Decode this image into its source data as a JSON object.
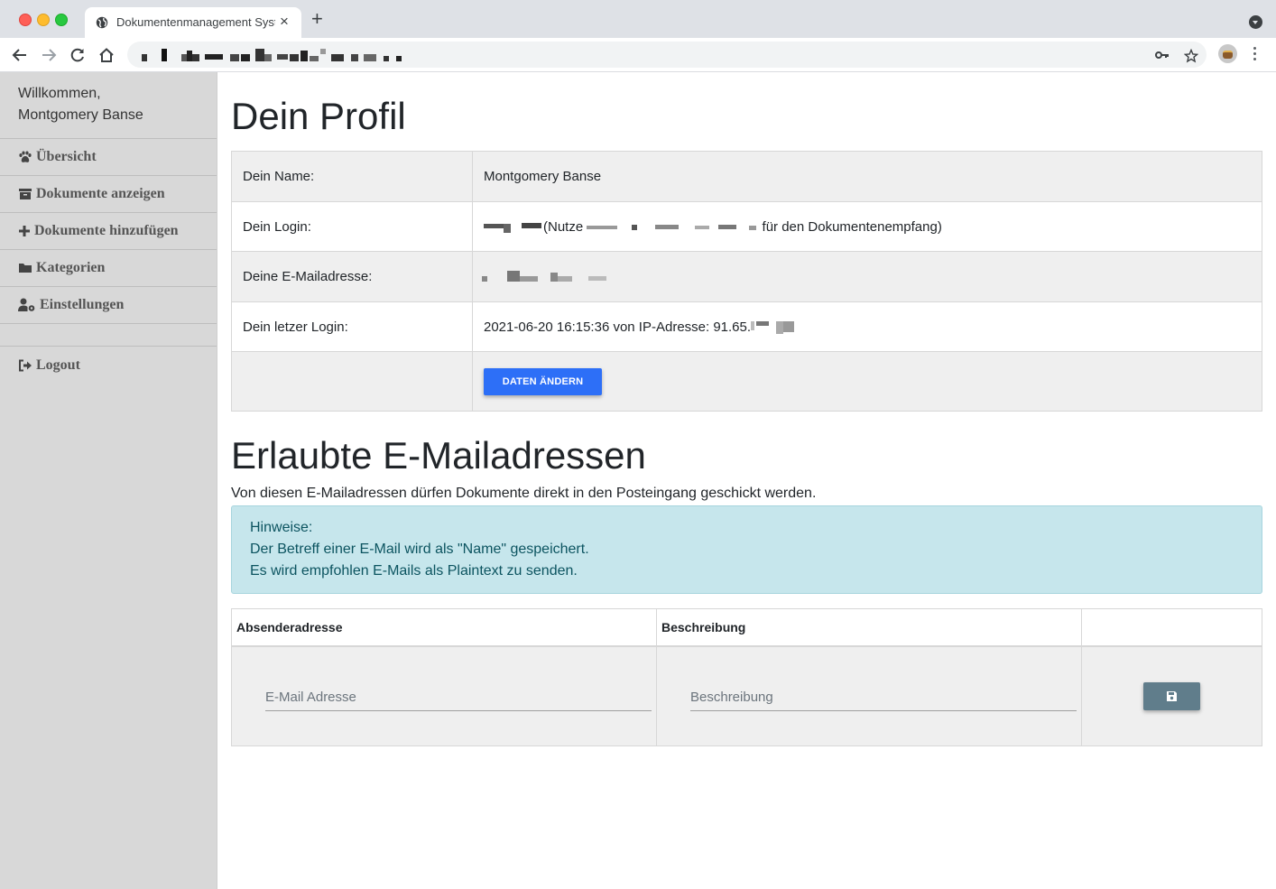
{
  "browser": {
    "tab_title": "Dokumentenmanagement System",
    "tab_close": "×",
    "new_tab": "+"
  },
  "sidebar": {
    "welcome_line1": "Willkommen,",
    "welcome_line2": "Montgomery Banse",
    "items": [
      {
        "label": "Übersicht",
        "icon": "paw-icon"
      },
      {
        "label": "Dokumente anzeigen",
        "icon": "archive-icon"
      },
      {
        "label": "Dokumente hinzufügen",
        "icon": "plus-icon"
      },
      {
        "label": "Kategorien",
        "icon": "folder-icon"
      },
      {
        "label": "Einstellungen",
        "icon": "user-cog-icon"
      }
    ],
    "logout": "Logout"
  },
  "profile": {
    "heading": "Dein Profil",
    "rows": [
      {
        "label": "Dein Name:",
        "value": "Montgomery Banse"
      },
      {
        "label": "Dein Login:",
        "value_prefix": "(Nutze",
        "value_suffix": "für den Dokumentenempfang)"
      },
      {
        "label": "Deine E-Mailadresse:"
      },
      {
        "label": "Dein letzer Login:",
        "value": "2021-06-20 16:15:36 von IP-Adresse: 91.65."
      }
    ],
    "button": "DATEN ÄNDERN"
  },
  "allowed": {
    "heading": "Erlaubte E-Mailadressen",
    "intro": "Von diesen E-Mailadressen dürfen Dokumente direkt in den Posteingang geschickt werden.",
    "alert_title": "Hinweise:",
    "alert_line1": "Der Betreff einer E-Mail wird als \"Name\" gespeichert.",
    "alert_line2": "Es wird empfohlen E-Mails als Plaintext zu senden.",
    "columns": [
      "Absenderadresse",
      "Beschreibung",
      ""
    ],
    "email_placeholder": "E-Mail Adresse",
    "description_placeholder": "Beschreibung",
    "save_icon": "save-icon"
  }
}
